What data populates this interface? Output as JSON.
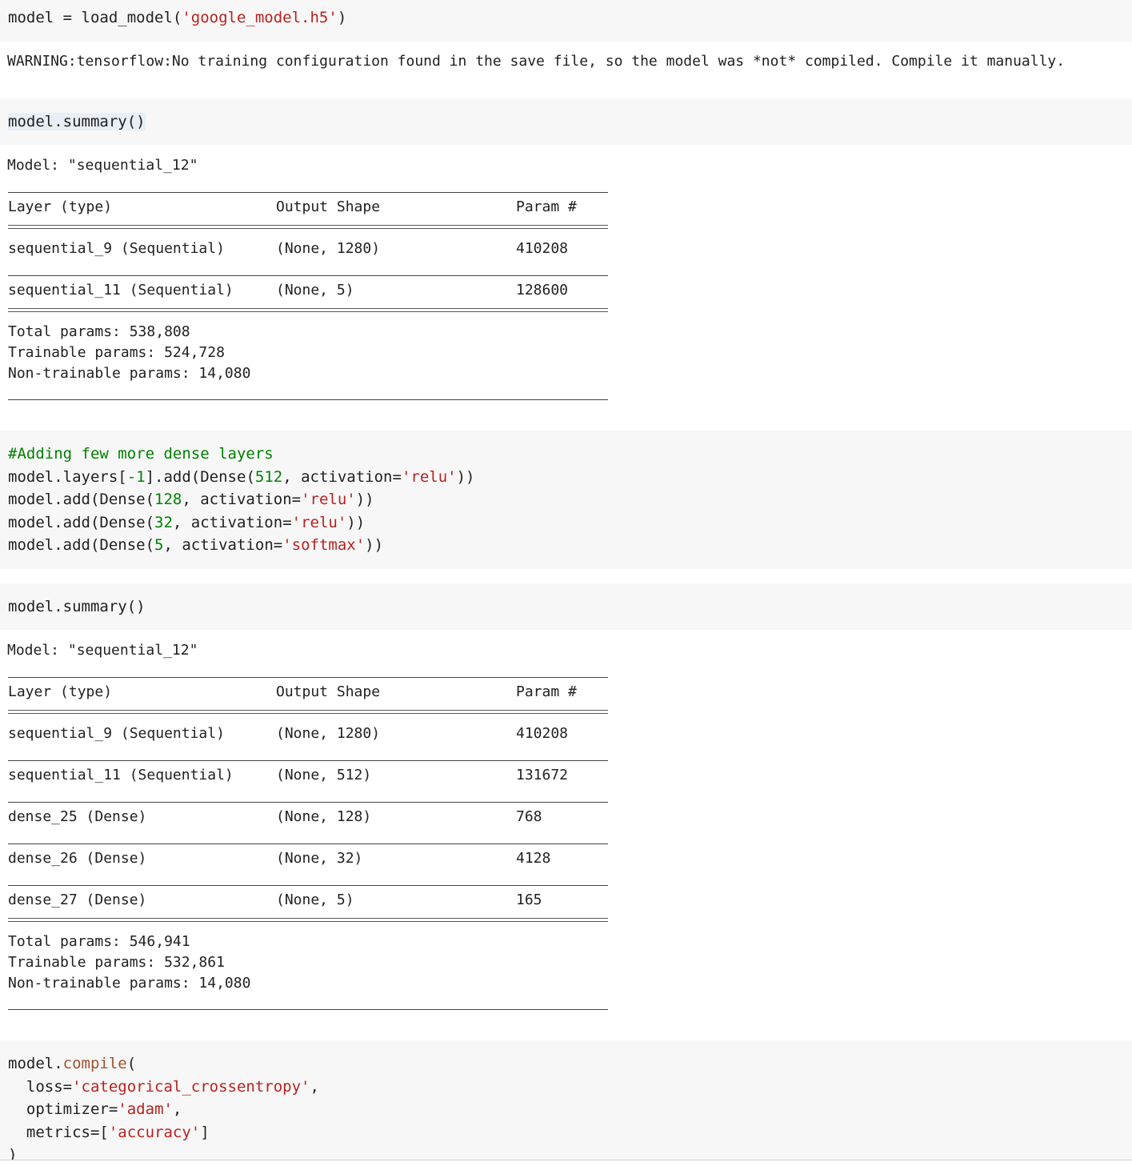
{
  "cells": {
    "load": {
      "code": [
        "model = load_model(",
        "'google_model.h5'",
        ")"
      ],
      "warning": "WARNING:tensorflow:No training configuration found in the save file, so the model was *not* compiled. Compile it manually."
    },
    "summary1": {
      "code": "model.summary()",
      "model_line": "Model: \"sequential_12\"",
      "headers": [
        "Layer (type)",
        "Output Shape",
        "Param #"
      ],
      "rows": [
        [
          "sequential_9 (Sequential)",
          "(None, 1280)",
          "410208"
        ],
        [
          "sequential_11 (Sequential)",
          "(None, 5)",
          "128600"
        ]
      ],
      "totals": [
        "Total params: 538,808",
        "Trainable params: 524,728",
        "Non-trainable params: 14,080"
      ]
    },
    "dense": {
      "comment": "#Adding few more dense layers",
      "lines": [
        {
          "pre": "model.layers[",
          "num1": "-1",
          "mid": "].add(Dense(",
          "num2": "512",
          "mid2": ", activation=",
          "str": "'relu'",
          "post": "))"
        },
        {
          "pre": "model.add(Dense(",
          "num2": "128",
          "mid2": ", activation=",
          "str": "'relu'",
          "post": "))"
        },
        {
          "pre": "model.add(Dense(",
          "num2": "32",
          "mid2": ", activation=",
          "str": "'relu'",
          "post": "))"
        },
        {
          "pre": "model.add(Dense(",
          "num2": "5",
          "mid2": ", activation=",
          "str": "'softmax'",
          "post": "))"
        }
      ]
    },
    "summary2": {
      "code": "model.summary()",
      "model_line": "Model: \"sequential_12\"",
      "headers": [
        "Layer (type)",
        "Output Shape",
        "Param #"
      ],
      "rows": [
        [
          "sequential_9 (Sequential)",
          "(None, 1280)",
          "410208"
        ],
        [
          "sequential_11 (Sequential)",
          "(None, 512)",
          "131672"
        ],
        [
          "dense_25 (Dense)",
          "(None, 128)",
          "768"
        ],
        [
          "dense_26 (Dense)",
          "(None, 32)",
          "4128"
        ],
        [
          "dense_27 (Dense)",
          "(None, 5)",
          "165"
        ]
      ],
      "totals": [
        "Total params: 546,941",
        "Trainable params: 532,861",
        "Non-trainable params: 14,080"
      ]
    },
    "compile": {
      "l1": [
        "model.",
        "compile",
        "("
      ],
      "l2": [
        "  loss=",
        "'categorical_crossentropy'",
        ","
      ],
      "l3": [
        "  optimizer=",
        "'adam'",
        ","
      ],
      "l4": [
        "  metrics=[",
        "'accuracy'",
        "]"
      ],
      "l5": ")"
    }
  },
  "colors": {
    "input_bg": "#f7f7f7",
    "string": "#ba2121",
    "number": "#008000",
    "comment": "#008000",
    "function": "#a0522d"
  }
}
